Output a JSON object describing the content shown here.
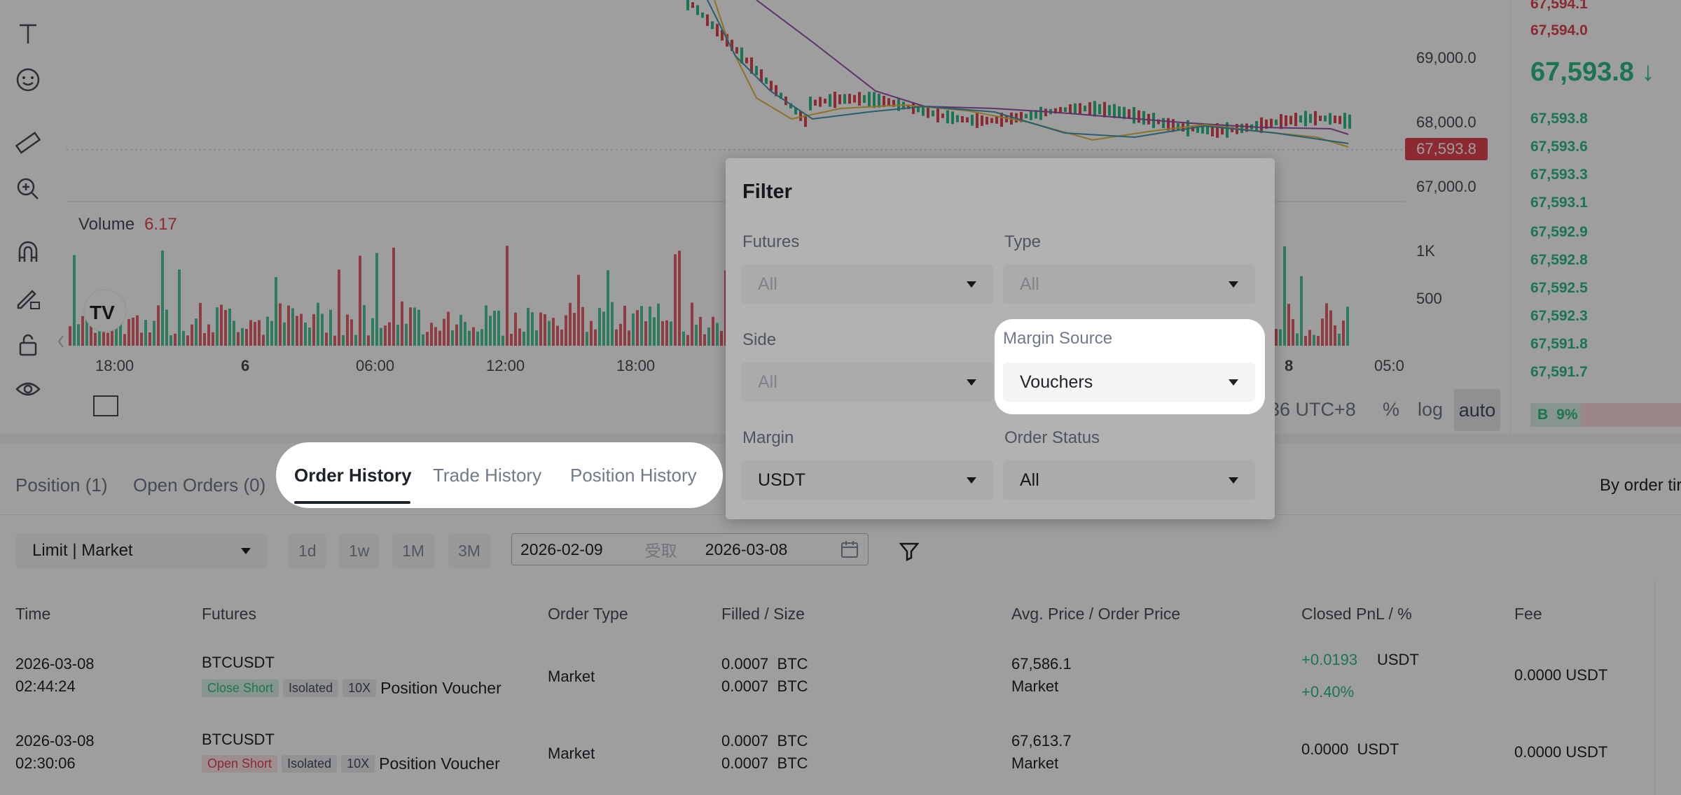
{
  "chart": {
    "price_axis": [
      "69,000.0",
      "68,000.0",
      "67,000.0"
    ],
    "current_price_tag": "67,593.8",
    "volume_axis": [
      "1K",
      "500"
    ],
    "volume_label": "Volume",
    "volume_value": "6.17",
    "time_axis": [
      "18:00",
      "6",
      "06:00",
      "12:00",
      "18:00",
      "8",
      "05:0"
    ],
    "controls": {
      "timezone": "36 UTC+8",
      "percent": "%",
      "log": "log",
      "auto": "auto"
    },
    "colors": {
      "up": "#2ebd85",
      "down": "#e0444f",
      "ma_long": "#9b4fb0",
      "ma_short": "#e5b93c"
    }
  },
  "orderbook": {
    "asks": [
      "67,594.1",
      "67,594.0"
    ],
    "last_price": "67,593.8 ↓",
    "bids": [
      "67,593.8",
      "67,593.6",
      "67,593.3",
      "67,593.1",
      "67,592.9",
      "67,592.8",
      "67,592.5",
      "67,592.3",
      "67,591.8",
      "67,591.7"
    ],
    "buy_label": "B",
    "buy_ratio": "9%"
  },
  "tabs": {
    "position": "Position (1)",
    "open_orders": "Open Orders (0)",
    "order_history": "Order History",
    "trade_history": "Trade History",
    "position_history": "Position History",
    "by_order": "By order tir"
  },
  "toolbar": {
    "order_type": "Limit | Market",
    "ranges": [
      "1d",
      "1w",
      "1M",
      "3M"
    ],
    "date_from": "2026-02-09",
    "date_sep": "受取",
    "date_to": "2026-03-08"
  },
  "table": {
    "headers": [
      "Time",
      "Futures",
      "Order Type",
      "Filled / Size",
      "Avg. Price / Order Price",
      "Closed PnL / %",
      "Fee"
    ],
    "rows": [
      {
        "date": "2026-03-08",
        "time": "02:44:24",
        "symbol": "BTCUSDT",
        "side_tag": "Close Short",
        "mode_tag": "Isolated",
        "lev_tag": "10X",
        "voucher": "Position Voucher",
        "order_type": "Market",
        "filled": "0.0007  BTC",
        "size": "0.0007  BTC",
        "avg_price": "67,586.1",
        "order_price": "Market",
        "pnl": "+0.0193",
        "pnl_unit": "USDT",
        "pnl_pct": "+0.40%",
        "fee": "0.0000 USDT"
      },
      {
        "date": "2026-03-08",
        "time": "02:30:06",
        "symbol": "BTCUSDT",
        "side_tag": "Open Short",
        "mode_tag": "Isolated",
        "lev_tag": "10X",
        "voucher": "Position Voucher",
        "order_type": "Market",
        "filled": "0.0007  BTC",
        "size": "0.0007  BTC",
        "avg_price": "67,613.7",
        "order_price": "Market",
        "pnl": "0.0000  USDT",
        "pnl_unit": "",
        "pnl_pct": "",
        "fee": "0.0000 USDT"
      }
    ]
  },
  "filter": {
    "title": "Filter",
    "futures_label": "Futures",
    "futures_value": "All",
    "type_label": "Type",
    "type_value": "All",
    "side_label": "Side",
    "side_value": "All",
    "margin_source_label": "Margin Source",
    "margin_source_value": "Vouchers",
    "margin_label": "Margin",
    "margin_value": "USDT",
    "order_status_label": "Order Status",
    "order_status_value": "All"
  }
}
